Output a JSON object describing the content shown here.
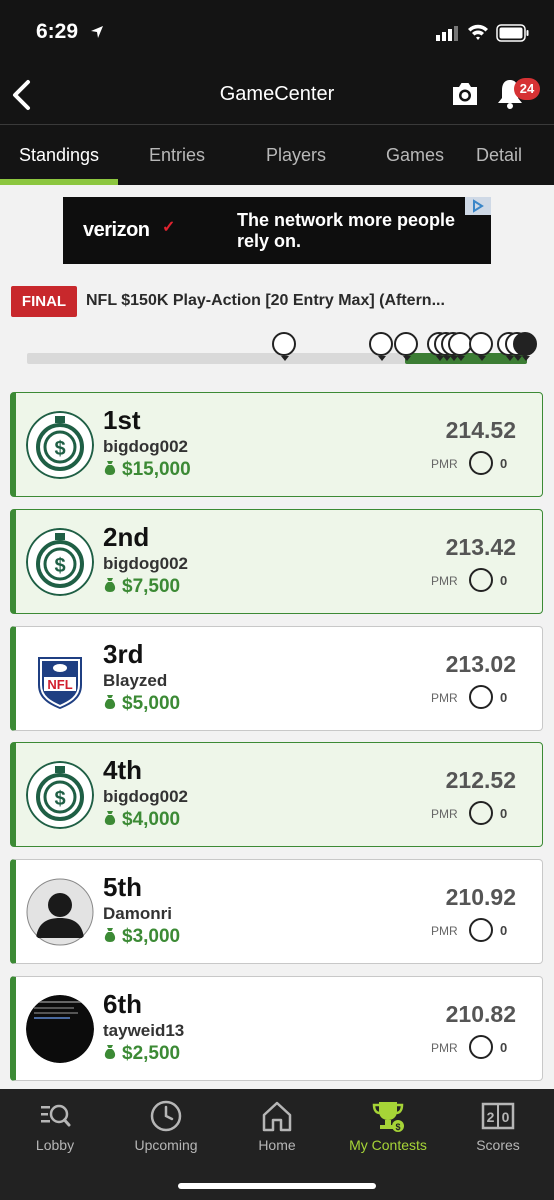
{
  "status_bar": {
    "time": "6:29"
  },
  "header": {
    "title": "GameCenter",
    "notification_count": "24"
  },
  "tabs": [
    {
      "label": "Standings",
      "active": true
    },
    {
      "label": "Entries",
      "active": false
    },
    {
      "label": "Players",
      "active": false
    },
    {
      "label": "Games",
      "active": false
    },
    {
      "label": "Detail",
      "active": false
    }
  ],
  "ad": {
    "brand": "verizon",
    "brand_mark": "✓",
    "tagline": "The network more people rely on."
  },
  "contest": {
    "status": "FINAL",
    "title": "NFL $150K Play-Action [20 Entry Max] (Aftern..."
  },
  "standings": [
    {
      "rank": "1st",
      "username": "bigdog002",
      "prize": "$15,000",
      "score": "214.52",
      "pmr_label": "PMR",
      "pmr": "0",
      "avatar": "dollar-clock-avatar",
      "mine": true
    },
    {
      "rank": "2nd",
      "username": "bigdog002",
      "prize": "$7,500",
      "score": "213.42",
      "pmr_label": "PMR",
      "pmr": "0",
      "avatar": "dollar-clock-avatar",
      "mine": true
    },
    {
      "rank": "3rd",
      "username": "Blayzed",
      "prize": "$5,000",
      "score": "213.02",
      "pmr_label": "PMR",
      "pmr": "0",
      "avatar": "nfl-shield-avatar",
      "mine": false
    },
    {
      "rank": "4th",
      "username": "bigdog002",
      "prize": "$4,000",
      "score": "212.52",
      "pmr_label": "PMR",
      "pmr": "0",
      "avatar": "dollar-clock-avatar",
      "mine": true
    },
    {
      "rank": "5th",
      "username": "Damonri",
      "prize": "$3,000",
      "score": "210.92",
      "pmr_label": "PMR",
      "pmr": "0",
      "avatar": "silhouette-avatar",
      "mine": false
    },
    {
      "rank": "6th",
      "username": "tayweid13",
      "prize": "$2,500",
      "score": "210.82",
      "pmr_label": "PMR",
      "pmr": "0",
      "avatar": "photo-avatar",
      "mine": false
    }
  ],
  "bottom_nav": [
    {
      "label": "Lobby",
      "icon": "search-list-icon",
      "active": false
    },
    {
      "label": "Upcoming",
      "icon": "clock-icon",
      "active": false
    },
    {
      "label": "Home",
      "icon": "home-icon",
      "active": false
    },
    {
      "label": "My Contests",
      "icon": "trophy-icon",
      "active": true
    },
    {
      "label": "Scores",
      "icon": "scoreboard-icon",
      "active": false
    }
  ],
  "colors": {
    "accent_green": "#8cc63f",
    "prize_green": "#3c8a35",
    "final_red": "#c8282c",
    "badge_red": "#d63234",
    "dark_bg": "#141414"
  }
}
